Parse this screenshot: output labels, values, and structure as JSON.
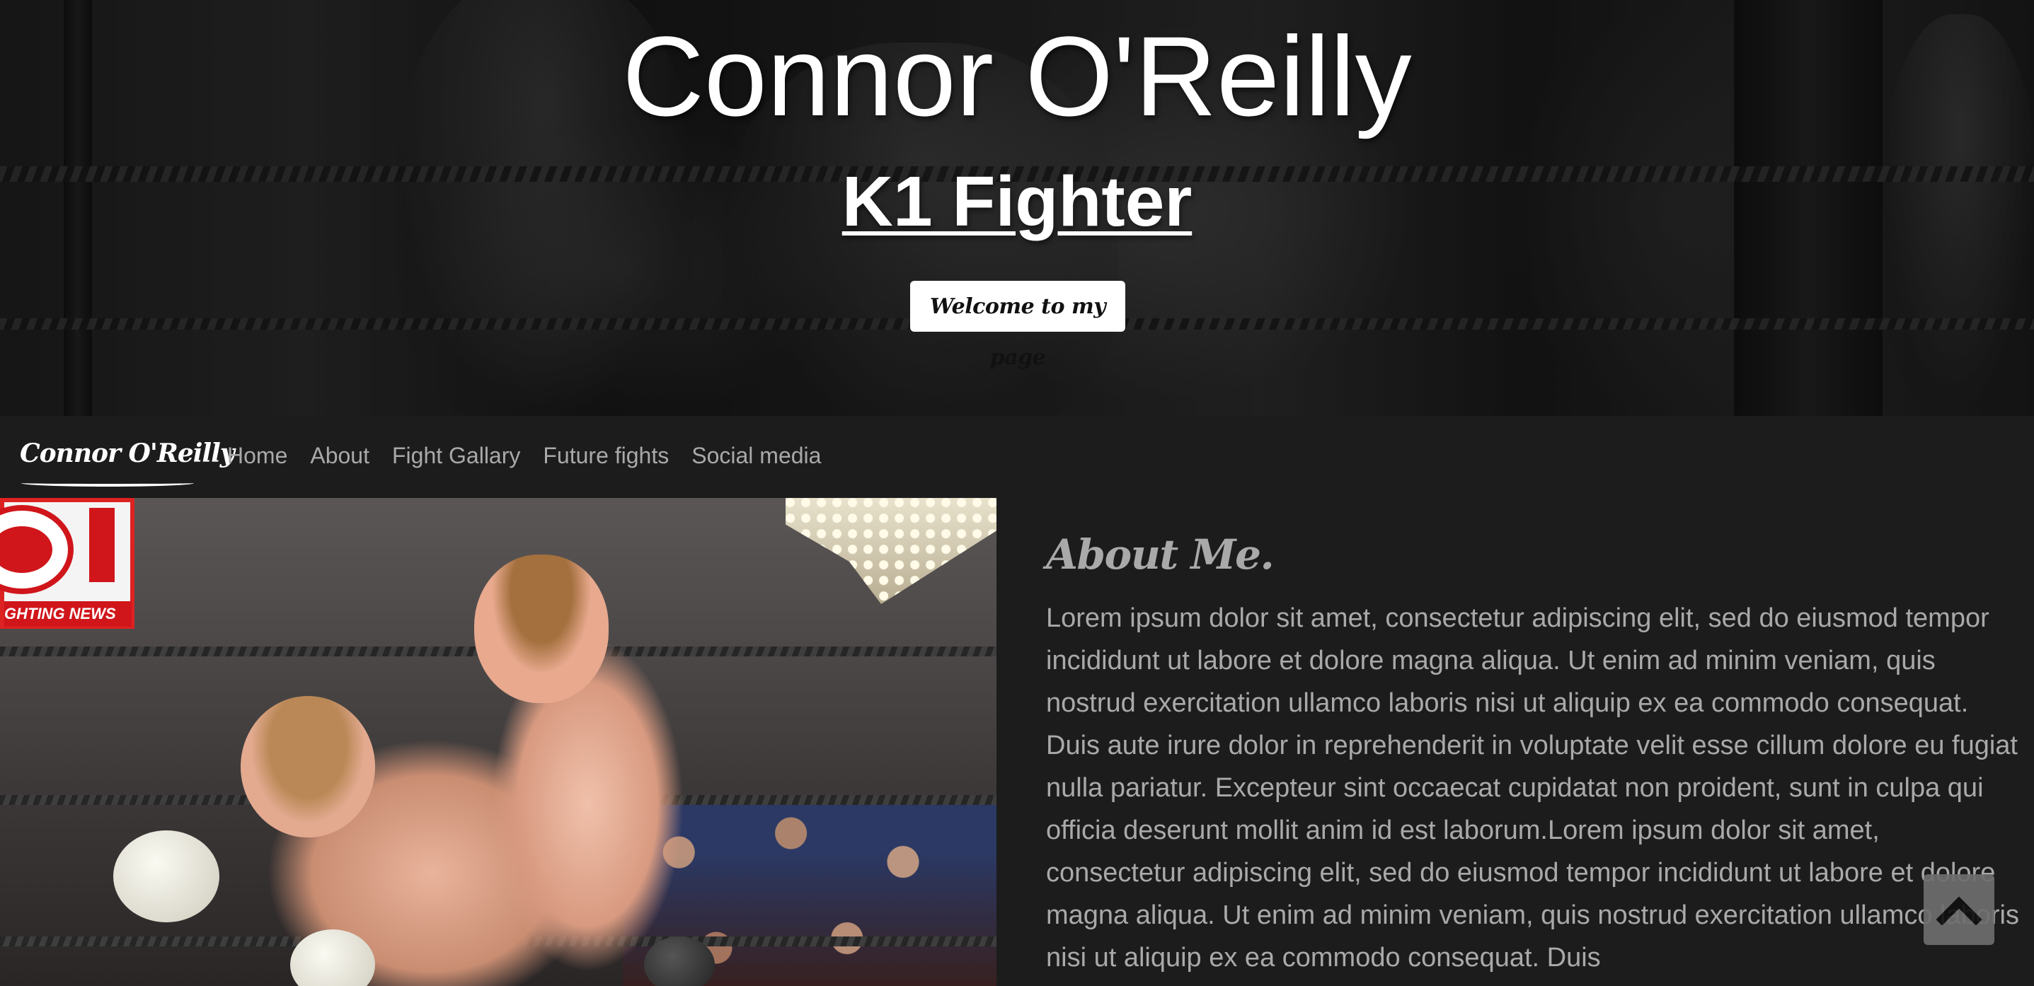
{
  "hero": {
    "title": "Connor O'Reilly",
    "subtitle": "K1 Fighter",
    "button_label": "Welcome to my page"
  },
  "navbar": {
    "brand": "Connor O'Reilly",
    "links": [
      {
        "label": "Home"
      },
      {
        "label": "About"
      },
      {
        "label": "Fight Gallary"
      },
      {
        "label": "Future fights"
      },
      {
        "label": "Social media"
      }
    ]
  },
  "photo": {
    "sign_text": "GHTING NEWS"
  },
  "about": {
    "heading": "About Me.",
    "body": "Lorem ipsum dolor sit amet, consectetur adipiscing elit, sed do eiusmod tempor incididunt ut labore et dolore magna aliqua. Ut enim ad minim veniam, quis nostrud exercitation ullamco laboris nisi ut aliquip ex ea commodo consequat. Duis aute irure dolor in reprehenderit in voluptate velit esse cillum dolore eu fugiat nulla pariatur. Excepteur sint occaecat cupidatat non proident, sunt in culpa qui officia deserunt mollit anim id est laborum.Lorem ipsum dolor sit amet, consectetur adipiscing elit, sed do eiusmod tempor incididunt ut labore et dolore magna aliqua. Ut enim ad minim veniam, quis nostrud exercitation ullamco laboris nisi ut aliquip ex ea commodo consequat. Duis"
  },
  "scroll_top": {
    "icon": "chevron-up-icon"
  },
  "colors": {
    "page_background": "#1c1c1c",
    "nav_text": "#a9a9a9",
    "hero_text": "#ffffff",
    "scroll_button": "#6e6e6e"
  }
}
